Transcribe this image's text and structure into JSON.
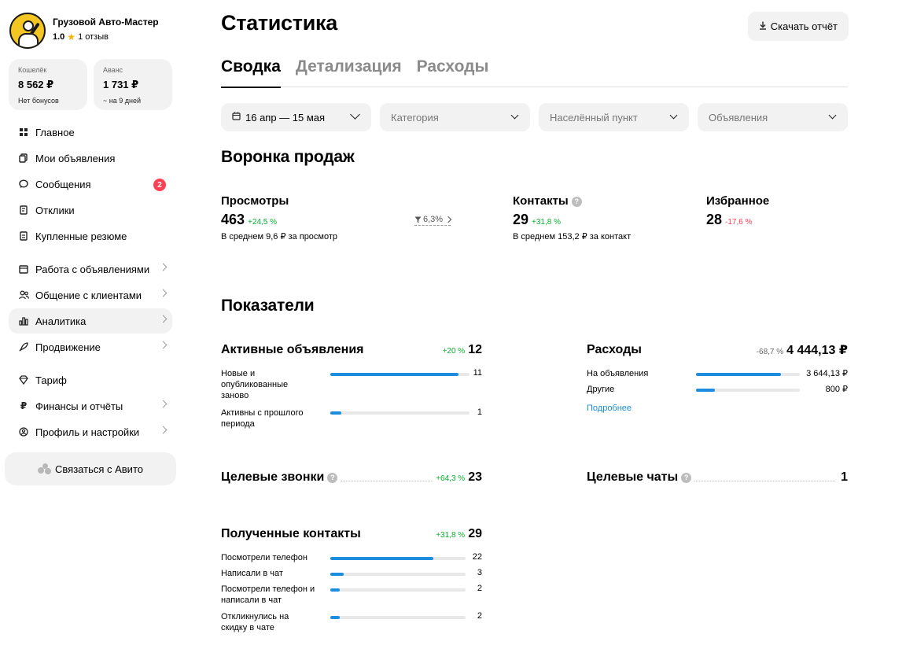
{
  "profile": {
    "name": "Грузовой Авто-Мастер",
    "rating": "1.0",
    "reviews": "1 отзыв"
  },
  "wallet": {
    "label": "Кошелёк",
    "value": "8 562 ₽",
    "sub": "Нет бонусов"
  },
  "advance": {
    "label": "Аванс",
    "value": "1 731 ₽",
    "sub": "~ на 9 дней"
  },
  "nav": {
    "main": "Главное",
    "my_ads": "Мои объявления",
    "messages": "Сообщения",
    "messages_badge": "2",
    "responses": "Отклики",
    "bought_resumes": "Купленные резюме",
    "ads_work": "Работа с объявлениями",
    "clients": "Общение с клиентами",
    "analytics": "Аналитика",
    "promotion": "Продвижение",
    "tariff": "Тариф",
    "finance": "Финансы и отчёты",
    "profile_settings": "Профиль и настройки"
  },
  "contact_avito": "Связаться с Авито",
  "page_title": "Статистика",
  "download_label": "Скачать отчёт",
  "tabs": [
    "Сводка",
    "Детализация",
    "Расходы"
  ],
  "filters": {
    "date": "16 апр — 15 мая",
    "category": "Категория",
    "city": "Населённый пункт",
    "ads": "Объявления"
  },
  "funnel": {
    "title": "Воронка продаж",
    "views": {
      "title": "Просмотры",
      "value": "463",
      "change": "+24,5 %",
      "sub": "В среднем 9,6 ₽ за просмотр"
    },
    "conversion": "6,3%",
    "contacts": {
      "title": "Контакты",
      "value": "29",
      "change": "+31,8 %",
      "sub": "В среднем 153,2 ₽ за контакт"
    },
    "favorites": {
      "title": "Избранное",
      "value": "28",
      "change": "-17,6 %"
    }
  },
  "indicators": {
    "title": "Показатели",
    "active_ads": {
      "title": "Активные объявления",
      "change": "+20 %",
      "value": "12",
      "rows": [
        {
          "label": "Новые и опубликованные заново",
          "value": "11",
          "fraction": 0.92
        },
        {
          "label": "Активны с прошлого периода",
          "value": "1",
          "fraction": 0.08
        }
      ]
    },
    "expenses": {
      "title": "Расходы",
      "change": "-68,7 %",
      "value": "4 444,13 ₽",
      "rows": [
        {
          "label": "На объявления",
          "value": "3 644,13 ₽",
          "fraction": 0.82
        },
        {
          "label": "Другие",
          "value": "800 ₽",
          "fraction": 0.18
        }
      ],
      "more": "Подробнее"
    },
    "calls": {
      "title": "Целевые звонки",
      "change": "+64,3 %",
      "value": "23"
    },
    "chats": {
      "title": "Целевые чаты",
      "value": "1"
    },
    "contacts": {
      "title": "Полученные контакты",
      "change": "+31,8 %",
      "value": "29",
      "rows": [
        {
          "label": "Посмотрели телефон",
          "value": "22",
          "fraction": 0.76
        },
        {
          "label": "Написали в чат",
          "value": "3",
          "fraction": 0.1
        },
        {
          "label": "Посмотрели телефон и написали в чат",
          "value": "2",
          "fraction": 0.07
        },
        {
          "label": "Откликнулись на скидку в чате",
          "value": "2",
          "fraction": 0.07
        }
      ]
    }
  },
  "colors": {
    "accent": "#1c8ddf",
    "up": "#04b22b",
    "down": "#ff4053",
    "badge": "#ff4053"
  }
}
